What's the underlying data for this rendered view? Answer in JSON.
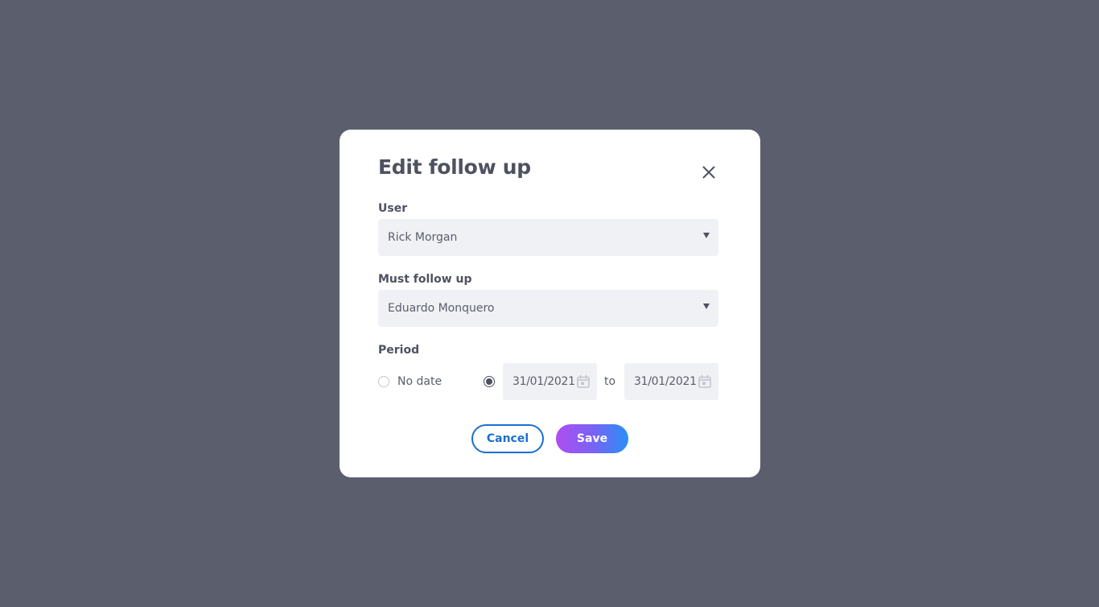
{
  "modal": {
    "title": "Edit follow up",
    "close_icon": "close-icon"
  },
  "user": {
    "label": "User",
    "value": "Rick Morgan"
  },
  "must_follow_up": {
    "label": "Must follow up",
    "value": "Eduardo Monquero"
  },
  "period": {
    "label": "Period",
    "no_date_label": "No date",
    "no_date_selected": false,
    "range_selected": true,
    "from": "31/01/2021",
    "to_label": "to",
    "to": "31/01/2021",
    "calendar_icon": "calendar-icon"
  },
  "actions": {
    "cancel": "Cancel",
    "save": "Save"
  },
  "colors": {
    "backdrop": "#5b5e6d",
    "text": "#4e5260",
    "field_bg": "#f0f1f5",
    "primary_blue": "#1a6fd0",
    "gradient_start": "#b04ef0",
    "gradient_end": "#2a8ff7"
  }
}
